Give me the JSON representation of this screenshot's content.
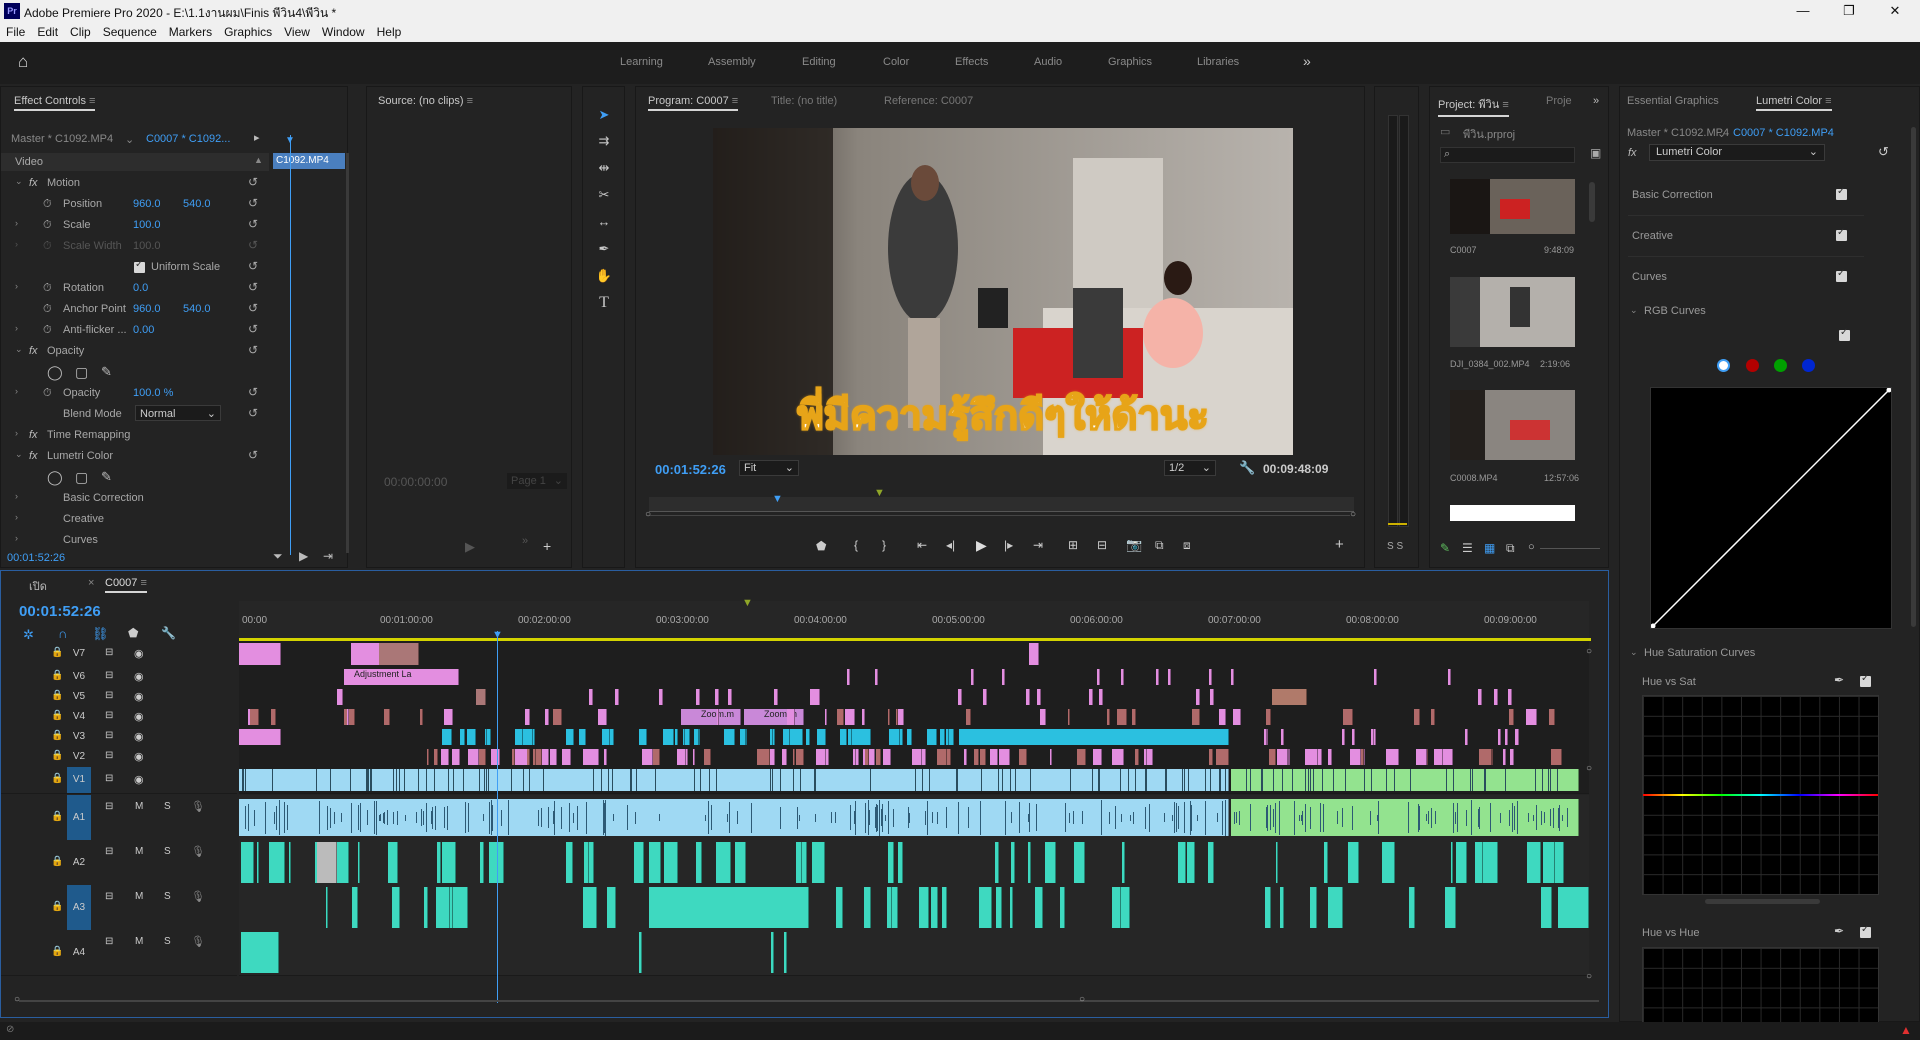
{
  "window": {
    "app_title": "Adobe Premiere Pro 2020 - E:\\1.1งานผม\\Finis พีวิน4\\พีวิน *",
    "app_icon": "Pr"
  },
  "menu": [
    "File",
    "Edit",
    "Clip",
    "Sequence",
    "Markers",
    "Graphics",
    "View",
    "Window",
    "Help"
  ],
  "workspaces": [
    "Learning",
    "Assembly",
    "Editing",
    "Color",
    "Effects",
    "Audio",
    "Graphics",
    "Libraries"
  ],
  "effect_controls": {
    "tab": "Effect Controls",
    "master_label": "Master * C1092.MP4",
    "clip_label": "C0007 * C1092...",
    "clip_chip": "C1092.MP4",
    "section_video": "Video",
    "motion": "Motion",
    "position_label": "Position",
    "position_x": "960.0",
    "position_y": "540.0",
    "scale_label": "Scale",
    "scale_value": "100.0",
    "scale_width_label": "Scale Width",
    "scale_width_value": "100.0",
    "uniform_scale": "Uniform Scale",
    "rotation_label": "Rotation",
    "rotation_value": "0.0",
    "anchor_label": "Anchor Point",
    "anchor_x": "960.0",
    "anchor_y": "540.0",
    "antiflicker_label": "Anti-flicker ...",
    "antiflicker_value": "0.00",
    "opacity": "Opacity",
    "opacity_label": "Opacity",
    "opacity_value": "100.0 %",
    "blend_label": "Blend Mode",
    "blend_value": "Normal",
    "time_remapping": "Time Remapping",
    "lumetri": "Lumetri Color",
    "basic_correction": "Basic Correction",
    "creative": "Creative",
    "curves": "Curves",
    "timecode": "00:01:52:26"
  },
  "source": {
    "tab": "Source: (no clips)",
    "timecode": "00:00:00:00",
    "page": "Page 1"
  },
  "program": {
    "tab": "Program: C0007",
    "title_tab": "Title: (no title)",
    "reference_tab": "Reference: C0007",
    "subtitle": "พี่มีความรู้สึกดีๆให้ด้านะ",
    "timecode": "00:01:52:26",
    "fit": "Fit",
    "resolution": "1/2",
    "duration": "00:09:48:09"
  },
  "meter": {
    "labels": "S S"
  },
  "project": {
    "tab": "Project: พีวิน",
    "tab2": "Proje",
    "file": "พีวิน.prproj",
    "items": [
      {
        "name": "C0007",
        "duration": "9:48:09"
      },
      {
        "name": "DJI_0384_002.MP4",
        "duration": "2:19:06"
      },
      {
        "name": "C0008.MP4",
        "duration": "12:57:06"
      }
    ]
  },
  "lumetri": {
    "tab1": "Essential Graphics",
    "tab2": "Lumetri Color",
    "master_label": "Master * C1092.MP4",
    "clip_label": "C0007 * C1092.MP4",
    "effect_select": "Lumetri Color",
    "basic_correction": "Basic Correction",
    "creative": "Creative",
    "curves": "Curves",
    "rgb_curves": "RGB Curves",
    "hue_sat_curves": "Hue Saturation Curves",
    "hue_vs_sat": "Hue vs Sat",
    "hue_vs_hue": "Hue vs Hue",
    "channel_colors": [
      "#ffffff",
      "#b30000",
      "#00a000",
      "#0026d1"
    ]
  },
  "timeline": {
    "tab_open": "เปิด",
    "tab_seq": "C0007",
    "timecode": "00:01:52:26",
    "ruler": [
      "00:00",
      "00:01:00:00",
      "00:02:00:00",
      "00:03:00:00",
      "00:04:00:00",
      "00:05:00:00",
      "00:06:00:00",
      "00:07:00:00",
      "00:08:00:00",
      "00:09:00:00"
    ],
    "video_tracks": [
      "V7",
      "V6",
      "V5",
      "V4",
      "V3",
      "V2",
      "V1"
    ],
    "audio_tracks": [
      "A1",
      "A2",
      "A3",
      "A4"
    ],
    "audio_buttons": {
      "mute": "M",
      "solo": "S"
    },
    "clip_labels": {
      "adjustment": "Adjustment La",
      "zoom1": "Zoom.m",
      "zoom2": "Zoom.m",
      "fx": "fx"
    }
  },
  "colors": {
    "accent_blue": "#3f9ef5",
    "clip_pink": "#e38ee0",
    "clip_blue": "#9fd9f3",
    "clip_green": "#93e38f",
    "clip_teal": "#3ed9c0",
    "clip_red": "#b06a6a",
    "clip_cyan": "#2bc0e0"
  }
}
